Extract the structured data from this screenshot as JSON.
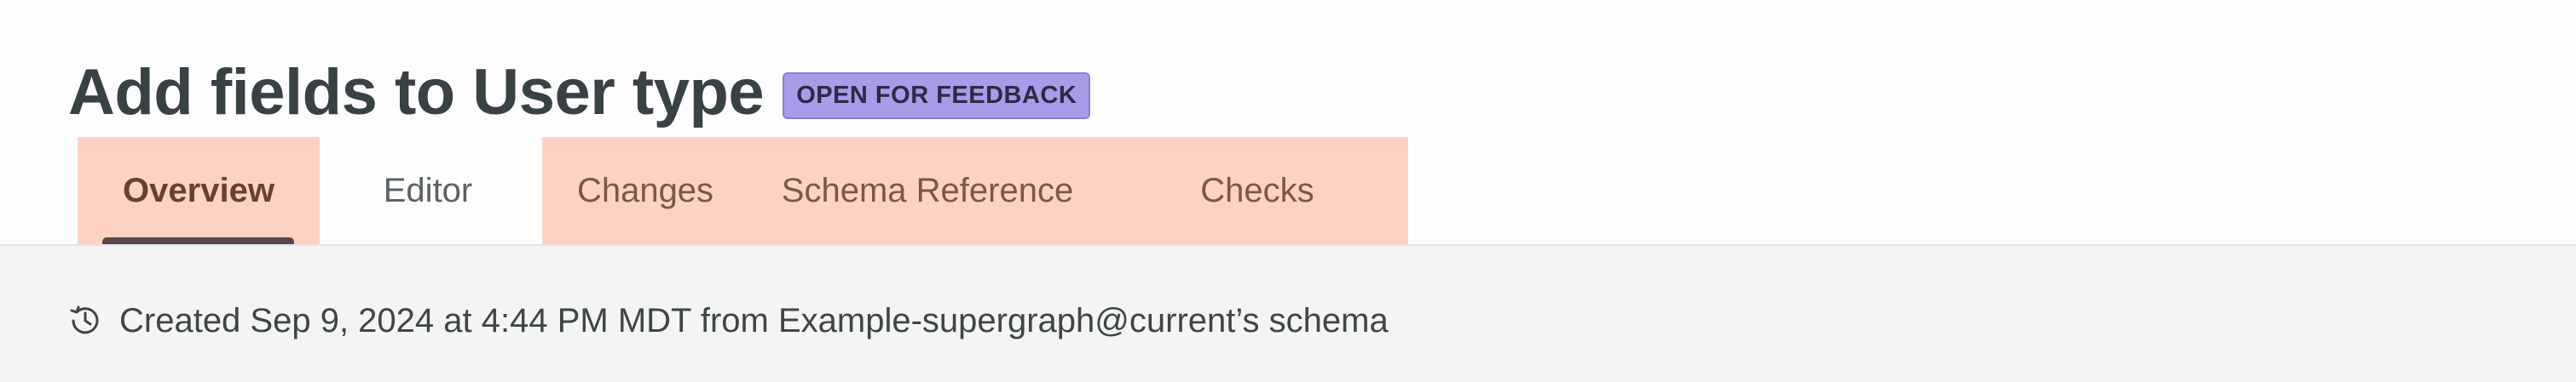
{
  "header": {
    "title": "Add fields to User type",
    "status_badge": "OPEN FOR FEEDBACK"
  },
  "tabs": [
    {
      "label": "Overview",
      "active": true
    },
    {
      "label": "Editor",
      "active": false
    },
    {
      "label": "Changes",
      "active": false
    },
    {
      "label": "Schema Reference",
      "active": false
    },
    {
      "label": "Checks",
      "active": false
    }
  ],
  "content": {
    "history_icon": "history-icon",
    "created_text": "Created Sep 9, 2024 at 4:44 PM MDT from Example-supergraph@current’s schema"
  },
  "colors": {
    "badge_bg": "#a79bea",
    "tab_highlight": "#fed2c2",
    "tab_underline": "#5a4747",
    "content_bg": "#f4f4f4"
  }
}
